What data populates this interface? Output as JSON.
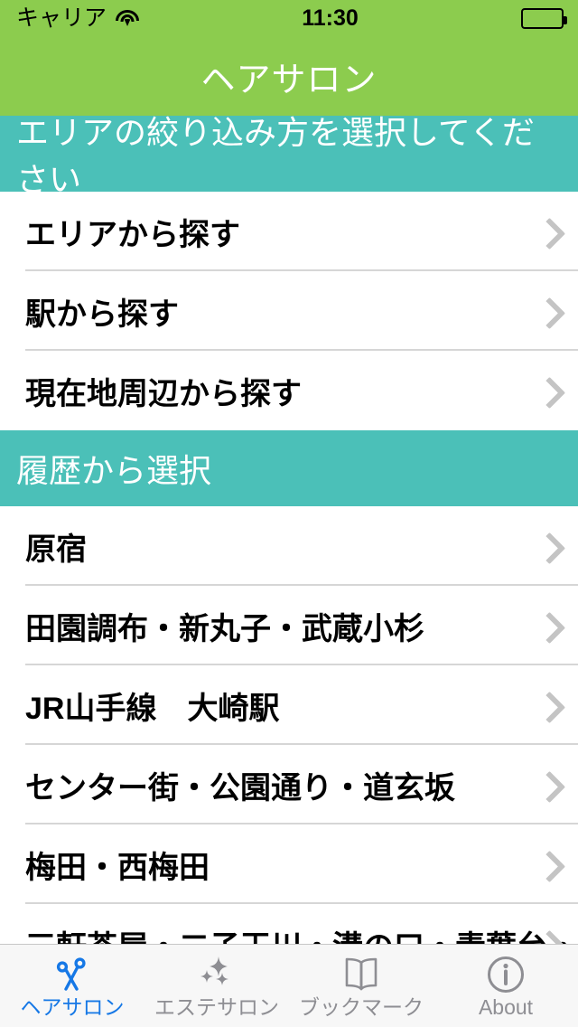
{
  "colors": {
    "brand_green": "#8CCC4E",
    "section_teal": "#4BC0B8",
    "tab_active": "#1678E6",
    "tab_inactive": "#8E8E93",
    "chevron": "#C4C4C4",
    "separator": "#D6D6D6"
  },
  "status_bar": {
    "carrier": "キャリア",
    "wifi_icon": "wifi-icon",
    "time": "11:30",
    "battery_icon": "battery-full-icon"
  },
  "nav": {
    "title": "ヘアサロン"
  },
  "sections": [
    {
      "header": "エリアの絞り込み方を選択してください",
      "rows": [
        {
          "label": "エリアから探す"
        },
        {
          "label": "駅から探す"
        },
        {
          "label": "現在地周辺から探す"
        }
      ]
    },
    {
      "header": "履歴から選択",
      "rows": [
        {
          "label": "原宿"
        },
        {
          "label": "田園調布・新丸子・武蔵小杉"
        },
        {
          "label": "JR山手線　大崎駅"
        },
        {
          "label": "センター街・公園通り・道玄坂"
        },
        {
          "label": "梅田・西梅田"
        },
        {
          "label": "三軒茶屋・二子玉川・溝の口・青葉台・池尻大橋・三軒茶屋・二子玉川"
        }
      ]
    }
  ],
  "tabs": [
    {
      "label": "ヘアサロン",
      "icon": "scissors-icon",
      "active": true
    },
    {
      "label": "エステサロン",
      "icon": "sparkles-icon",
      "active": false
    },
    {
      "label": "ブックマーク",
      "icon": "open-book-icon",
      "active": false
    },
    {
      "label": "About",
      "icon": "info-circle-icon",
      "active": false
    }
  ]
}
